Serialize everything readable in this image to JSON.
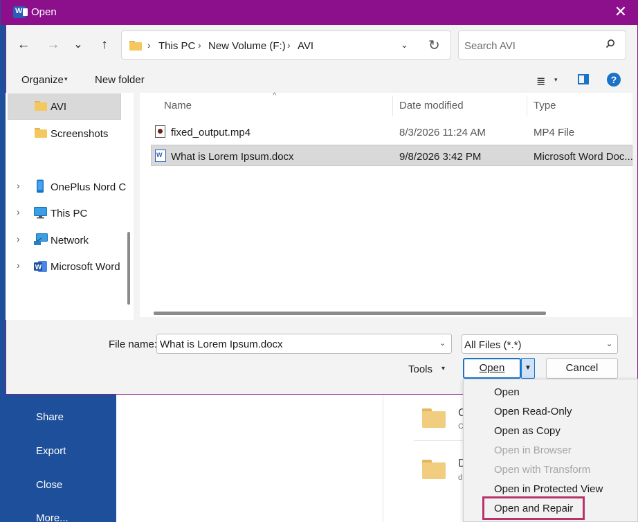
{
  "background": {
    "nav": [
      "Share",
      "Export",
      "Close",
      "More..."
    ],
    "items": [
      {
        "letter": "C",
        "sub": "C"
      },
      {
        "letter": "D",
        "sub": "d"
      }
    ]
  },
  "dialog": {
    "title": "Open",
    "close_glyph": "✕",
    "nav": {
      "back": "←",
      "forward": "→",
      "recent": "⌄",
      "up": "↑"
    },
    "address": {
      "crumbs": [
        "This PC",
        "New Volume (F:)",
        "AVI"
      ],
      "sep": "›",
      "chevron": "⌄",
      "refresh": "↻"
    },
    "search": {
      "placeholder": "Search AVI"
    },
    "toolbar": {
      "organize": "Organize",
      "organize_caret": "▾",
      "new_folder": "New folder",
      "view_glyph": "≣",
      "view_caret": "▾",
      "help": "?"
    },
    "sidebar": [
      {
        "label": "AVI",
        "selected": true
      },
      {
        "label": "Screenshots"
      },
      {
        "label": "OnePlus Nord C",
        "expand": "›"
      },
      {
        "label": "This PC",
        "expand": "›"
      },
      {
        "label": "Network",
        "expand": "›"
      },
      {
        "label": "Microsoft Word",
        "expand": "›"
      }
    ],
    "columns": {
      "name": "Name",
      "date": "Date modified",
      "type": "Type",
      "sort": "^"
    },
    "files": [
      {
        "name": "fixed_output.mp4",
        "date": "8/3/2026 11:24 AM",
        "type": "MP4 File"
      },
      {
        "name": "What is Lorem Ipsum.docx",
        "date": "9/8/2026 3:42 PM",
        "type": "Microsoft Word Doc...",
        "selected": true
      }
    ],
    "bottom": {
      "file_name_label": "File name:",
      "file_name_value": "What is Lorem Ipsum.docx",
      "file_type": "All Files (*.*)",
      "tools": "Tools",
      "open": "Open",
      "cancel": "Cancel",
      "caret": "▾",
      "split": "▼"
    },
    "open_menu": [
      {
        "label": "Open"
      },
      {
        "label": "Open Read-Only"
      },
      {
        "label": "Open as Copy"
      },
      {
        "label": "Open in Browser",
        "disabled": true
      },
      {
        "label": "Open with Transform",
        "disabled": true
      },
      {
        "label": "Open in Protected View"
      },
      {
        "label": "Open and Repair",
        "highlighted": true
      }
    ]
  },
  "colors": {
    "titlebar": "#8c0f8c",
    "accent": "#1a73c7",
    "highlight": "#b8336a",
    "backstage": "#1e4f9a"
  }
}
